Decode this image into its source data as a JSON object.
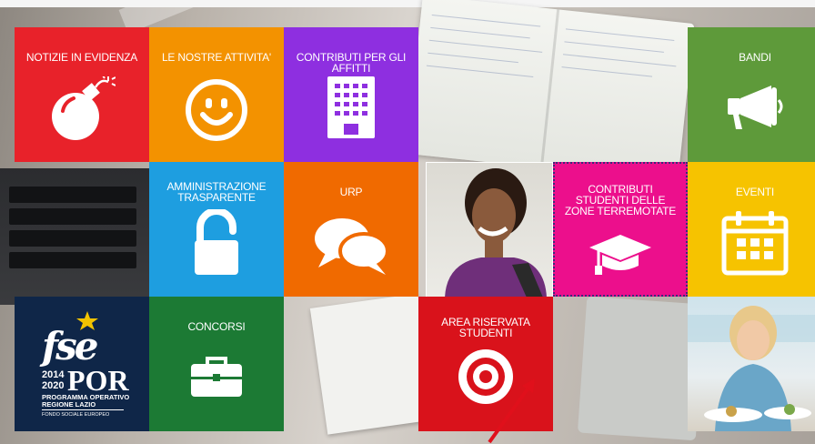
{
  "tiles": [
    {
      "id": "notizie",
      "label": "NOTIZIE IN EVIDENZA",
      "color": "#e8222a",
      "icon": "bomb-icon"
    },
    {
      "id": "attivita",
      "label": "LE NOSTRE ATTIVITA'",
      "color": "#f39200",
      "icon": "smiley-icon"
    },
    {
      "id": "contributi-affitti",
      "label": "CONTRIBUTI PER GLI AFFITTI",
      "color": "#8e2fe0",
      "icon": "building-icon"
    },
    {
      "id": "bandi",
      "label": "BANDI",
      "color": "#5e9a3a",
      "icon": "megaphone-icon"
    },
    {
      "id": "amministrazione",
      "label": "AMMINISTRAZIONE TRASPARENTE",
      "color": "#1e9ee0",
      "icon": "unlock-icon"
    },
    {
      "id": "urp",
      "label": "URP",
      "color": "#f06a00",
      "icon": "chat-bubbles-icon"
    },
    {
      "id": "contributi-terremotate",
      "label": "CONTRIBUTI STUDENTI DELLE ZONE TERREMOTATE",
      "color": "#ec0f8c",
      "icon": "graduation-cap-icon"
    },
    {
      "id": "eventi",
      "label": "EVENTI",
      "color": "#f6c300",
      "icon": "calendar-icon"
    },
    {
      "id": "concorsi",
      "label": "CONCORSI",
      "color": "#1c7a34",
      "icon": "briefcase-icon"
    },
    {
      "id": "area-riservata",
      "label": "AREA RISERVATA STUDENTI",
      "color": "#d9121b",
      "icon": "target-icon"
    }
  ],
  "fse_logo": {
    "bg": "#0f2648",
    "mark": "fse",
    "years_top": "2014",
    "years_bottom": "2020",
    "por": "POR",
    "line1": "PROGRAMMA OPERATIVO",
    "line2": "REGIONE LAZIO",
    "footer": "FONDO SOCIALE EUROPEO"
  }
}
